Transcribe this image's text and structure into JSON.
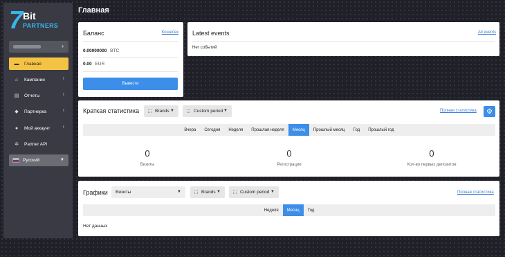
{
  "logo": {
    "number": "7",
    "bit": "Bit",
    "partners": "PARTNERS"
  },
  "sidebar": {
    "items": [
      {
        "label": "Главная",
        "icon": "wallet-icon",
        "glyph": "▬",
        "active": true
      },
      {
        "label": "Кампании",
        "icon": "home-icon",
        "glyph": "⌂"
      },
      {
        "label": "Отчеты",
        "icon": "document-icon",
        "glyph": "▤"
      },
      {
        "label": "Партнерка",
        "icon": "diamond-icon",
        "glyph": "◆"
      },
      {
        "label": "Мой аккаунт",
        "icon": "user-icon",
        "glyph": "●"
      },
      {
        "label": "Partner API",
        "icon": "gear-icon",
        "glyph": "✲"
      }
    ],
    "language": "Русский"
  },
  "page": {
    "title": "Главная"
  },
  "balance": {
    "title": "Баланс",
    "wallet_link": "Кошелек",
    "btc_amount": "0.00000000",
    "btc_currency": "BTC",
    "eur_amount": "0.00",
    "eur_currency": "EUR",
    "withdraw_label": "Вывести"
  },
  "events": {
    "title": "Latest events",
    "all_link": "All events",
    "empty_text": "Нет событий"
  },
  "stats": {
    "title": "Краткая статистика",
    "brands_select": "Brands",
    "period_select": "Custom period",
    "full_link": "Полная статистика",
    "tabs": [
      "Вчера",
      "Сегодня",
      "Неделя",
      "Прошлая неделя",
      "Месяц",
      "Прошлый месяц",
      "Год",
      "Прошлый год"
    ],
    "active_tab": "Месяц",
    "metrics": [
      {
        "value": "0",
        "label": "Визиты"
      },
      {
        "value": "0",
        "label": "Регистрации"
      },
      {
        "value": "0",
        "label": "Кол-во первых депозитов"
      }
    ]
  },
  "charts": {
    "title": "Графики",
    "metric_select": "Визиты",
    "brands_select": "Brands",
    "period_select": "Custom period",
    "full_link": "Полная статистика",
    "tabs": [
      "Неделя",
      "Месяц",
      "Год"
    ],
    "active_tab": "Месяц",
    "empty_text": "Нет данных"
  },
  "colors": {
    "accent": "#3d8ee8",
    "active_nav": "#f5c344",
    "sidebar": "#393a44",
    "logo": "#35b7ea"
  }
}
